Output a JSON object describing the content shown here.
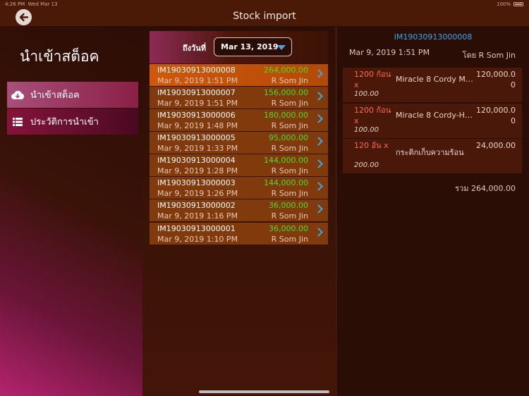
{
  "status_bar": {
    "time": "4:26 PM",
    "date": "Wed Mar 13",
    "battery": "100%"
  },
  "nav": {
    "title": "Stock import",
    "back_icon": "back-arrow-icon"
  },
  "sidebar": {
    "title": "นำเข้าสต็อค",
    "items": [
      {
        "label": "นำเข้าสต็อค",
        "icon": "cloud-download-icon"
      },
      {
        "label": "ประวัติการนำเข้า",
        "icon": "list-icon"
      }
    ]
  },
  "list": {
    "date_label": "ถึงวันที่",
    "date_value": "Mar 13, 2019",
    "rows": [
      {
        "id": "IM19030913000008",
        "amount": "264,000.00",
        "datetime": "Mar 9, 2019 1:51 PM",
        "by": "R Som Jin"
      },
      {
        "id": "IM19030913000007",
        "amount": "156,000.00",
        "datetime": "Mar 9, 2019 1:51 PM",
        "by": "R Som Jin"
      },
      {
        "id": "IM19030913000006",
        "amount": "180,000.00",
        "datetime": "Mar 9, 2019 1:48 PM",
        "by": "R Som Jin"
      },
      {
        "id": "IM19030913000005",
        "amount": "95,000.00",
        "datetime": "Mar 9, 2019 1:33 PM",
        "by": "R Som Jin"
      },
      {
        "id": "IM19030913000004",
        "amount": "144,000.00",
        "datetime": "Mar 9, 2019 1:28 PM",
        "by": "R Som Jin"
      },
      {
        "id": "IM19030913000003",
        "amount": "144,000.00",
        "datetime": "Mar 9, 2019 1:26 PM",
        "by": "R Som Jin"
      },
      {
        "id": "IM19030913000002",
        "amount": "36,000.00",
        "datetime": "Mar 9, 2019 1:16 PM",
        "by": "R Som Jin"
      },
      {
        "id": "IM19030913000001",
        "amount": "36,000.00",
        "datetime": "Mar 9, 2019 1:10 PM",
        "by": "R Som Jin"
      }
    ]
  },
  "detail": {
    "id": "IM19030913000008",
    "datetime": "Mar 9, 2019 1:51 PM",
    "by": "โดย R Som Jin",
    "items": [
      {
        "qty": "1200 ก้อน x",
        "price": "100.00",
        "name": "Miracle 8 Cordy Ma...",
        "total": "120,000.00"
      },
      {
        "qty": "1200 ก้อน x",
        "price": "100.00",
        "name": "Miracle 8 Cordy-He...",
        "total": "120,000.00"
      },
      {
        "qty": "120 อัน x",
        "price": "200.00",
        "name": "กระติกเก็บความร้อน",
        "total": "24,000.00"
      }
    ],
    "total": "รวม 264,000.00"
  },
  "colors": {
    "accent": "#3fa4e8",
    "amount_green": "#46e023",
    "qty_red": "#ff6a4d",
    "selected_row": "#d0580a"
  }
}
